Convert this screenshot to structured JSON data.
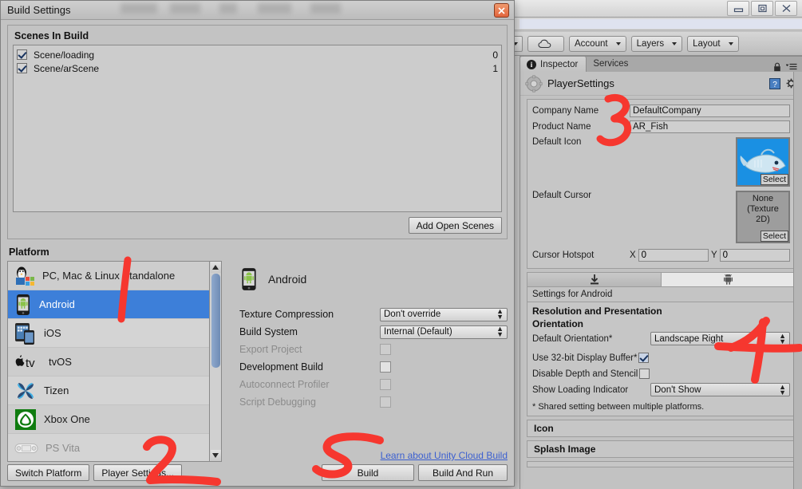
{
  "window": {
    "title": "Build Settings",
    "close_label": "x",
    "controls": [
      "minimize",
      "restore",
      "close"
    ]
  },
  "dialog": {
    "scenes_section": {
      "title": "Scenes In Build",
      "scenes": [
        {
          "name": "Scene/loading",
          "index": "0",
          "enabled": true
        },
        {
          "name": "Scene/arScene",
          "index": "1",
          "enabled": true
        }
      ],
      "add_open_scenes_label": "Add Open Scenes"
    },
    "platform_section": {
      "title": "Platform",
      "platforms": [
        {
          "label": "PC, Mac & Linux Standalone",
          "selected": false,
          "disabled": false,
          "icon": "pc-mac-linux-icon"
        },
        {
          "label": "Android",
          "selected": true,
          "disabled": false,
          "icon": "android-icon"
        },
        {
          "label": "iOS",
          "selected": false,
          "disabled": false,
          "icon": "ios-icon"
        },
        {
          "label": "tvOS",
          "selected": false,
          "disabled": false,
          "icon": "tvos-icon"
        },
        {
          "label": "Tizen",
          "selected": false,
          "disabled": false,
          "icon": "tizen-icon"
        },
        {
          "label": "Xbox One",
          "selected": false,
          "disabled": false,
          "icon": "xbox-icon"
        },
        {
          "label": "PS Vita",
          "selected": false,
          "disabled": true,
          "icon": "psvita-icon"
        }
      ]
    },
    "build_options": {
      "platform_name": "Android",
      "texture_compression_label": "Texture Compression",
      "texture_compression_value": "Don't override",
      "build_system_label": "Build System",
      "build_system_value": "Internal (Default)",
      "export_project_label": "Export Project",
      "export_project_checked": false,
      "development_build_label": "Development Build",
      "development_build_checked": false,
      "autoconnect_profiler_label": "Autoconnect Profiler",
      "autoconnect_profiler_checked": false,
      "script_debugging_label": "Script Debugging",
      "script_debugging_checked": false
    },
    "footer": {
      "cloud_build_link": "Learn about Unity Cloud Build",
      "switch_platform_label": "Switch Platform",
      "player_settings_label": "Player Settings...",
      "build_label": "Build",
      "build_and_run_label": "Build And Run"
    }
  },
  "editor": {
    "toolbar": {
      "cloud_icon": "cloud-icon",
      "account_label": "Account",
      "layers_label": "Layers",
      "layout_label": "Layout"
    },
    "inspector": {
      "tab_inspector": "Inspector",
      "tab_services": "Services",
      "lock_icon": "lock-icon",
      "menu_icon": "hamburger-menu-icon",
      "title": "PlayerSettings",
      "help_icon": "help-book-icon",
      "gear_icon": "gear-icon"
    },
    "player_settings": {
      "company_name_label": "Company Name",
      "company_name_value": "DefaultCompany",
      "product_name_label": "Product Name",
      "product_name_value": "AR_Fish",
      "default_icon_label": "Default Icon",
      "default_icon_select": "Select",
      "default_cursor_label": "Default Cursor",
      "default_cursor_value": "None\n(Texture 2D)",
      "default_cursor_value_line1": "None",
      "default_cursor_value_line2": "(Texture",
      "default_cursor_value_line3": "2D)",
      "default_cursor_select": "Select",
      "cursor_hotspot_label": "Cursor Hotspot",
      "cursor_hotspot_x_label": "X",
      "cursor_hotspot_x_value": "0",
      "cursor_hotspot_y_label": "Y",
      "cursor_hotspot_y_value": "0",
      "platform_tabs": [
        {
          "icon": "standalone-download-icon",
          "selected": false
        },
        {
          "icon": "android-icon",
          "selected": true
        }
      ],
      "settings_for_label": "Settings for Android",
      "resolution_section_title": "Resolution and Presentation",
      "orientation_subtitle": "Orientation",
      "default_orientation_label": "Default Orientation*",
      "default_orientation_value": "Landscape Right",
      "use_32bit_label": "Use 32-bit Display Buffer*",
      "use_32bit_checked": true,
      "disable_depth_label": "Disable Depth and Stencil",
      "disable_depth_checked": false,
      "loading_indicator_label": "Show Loading Indicator",
      "loading_indicator_value": "Don't Show",
      "shared_note": "* Shared setting between multiple platforms.",
      "icon_section_title": "Icon",
      "splash_section_title": "Splash Image"
    }
  },
  "annotations": {
    "color": "#f6372f",
    "marks": [
      {
        "id": "1",
        "target": "android-platform-row"
      },
      {
        "id": "2",
        "target": "player-settings-button"
      },
      {
        "id": "3",
        "target": "product-name-field"
      },
      {
        "id": "4",
        "target": "default-orientation-dropdown"
      },
      {
        "id": "5",
        "target": "build-button"
      }
    ]
  }
}
